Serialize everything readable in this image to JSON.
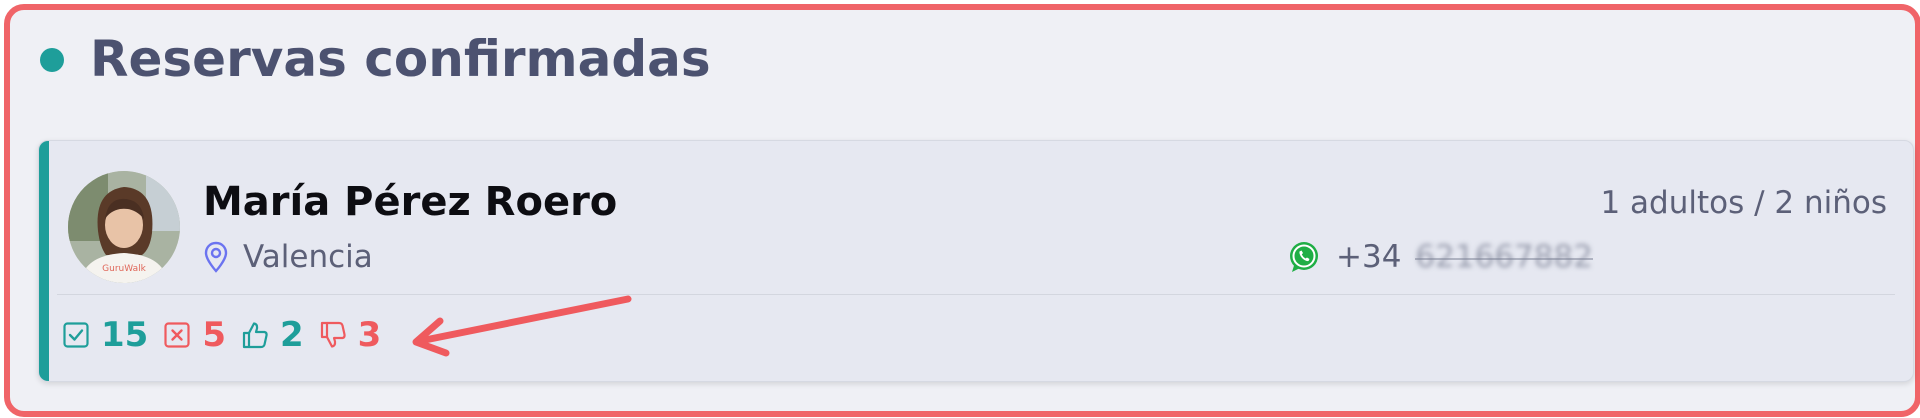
{
  "section": {
    "title": "Reservas confirmadas"
  },
  "card": {
    "avatar_name": "avatar-photo",
    "avatar_logo_text": "GuruWalk",
    "name": "María Pérez Roero",
    "location": "Valencia",
    "location_icon": "map-pin-icon",
    "guests": "1 adultos / 2 niños",
    "phone_prefix": "+34",
    "phone_number": "621667882",
    "phone_icon": "whatsapp-icon",
    "stats": [
      {
        "icon": "checkbox-check-icon",
        "value": "15"
      },
      {
        "icon": "checkbox-x-icon",
        "value": "5"
      },
      {
        "icon": "thumbs-up-icon",
        "value": "2"
      },
      {
        "icon": "thumbs-down-icon",
        "value": "3"
      }
    ]
  },
  "colors": {
    "accent": "#1e9e9a",
    "negative": "#ef5a5e",
    "frame_border": "#f06468",
    "title": "#4c5270",
    "whatsapp": "#1fae45"
  }
}
